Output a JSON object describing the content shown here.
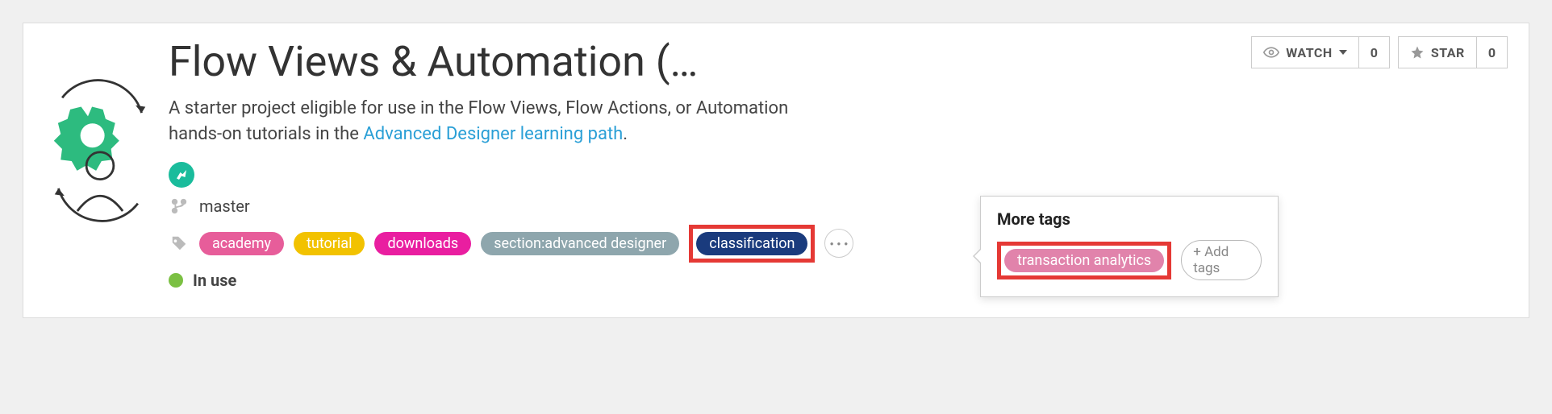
{
  "project": {
    "title": "Flow Views & Automation (…",
    "description_prefix": "A starter project eligible for use in the Flow Views, Flow Actions, or Automation hands-on tutorials in the ",
    "description_link": "Advanced Designer learning path",
    "description_suffix": ".",
    "branch": "master",
    "status_label": "In use"
  },
  "tags": {
    "academy": "academy",
    "tutorial": "tutorial",
    "downloads": "downloads",
    "section": "section:advanced designer",
    "classification": "classification",
    "more_ellipsis": "●●●"
  },
  "popover": {
    "title": "More tags",
    "transaction": "transaction analytics",
    "add_tags_label": "+ Add tags"
  },
  "actions": {
    "watch_label": "WATCH",
    "watch_count": "0",
    "star_label": "STAR",
    "star_count": "0"
  }
}
